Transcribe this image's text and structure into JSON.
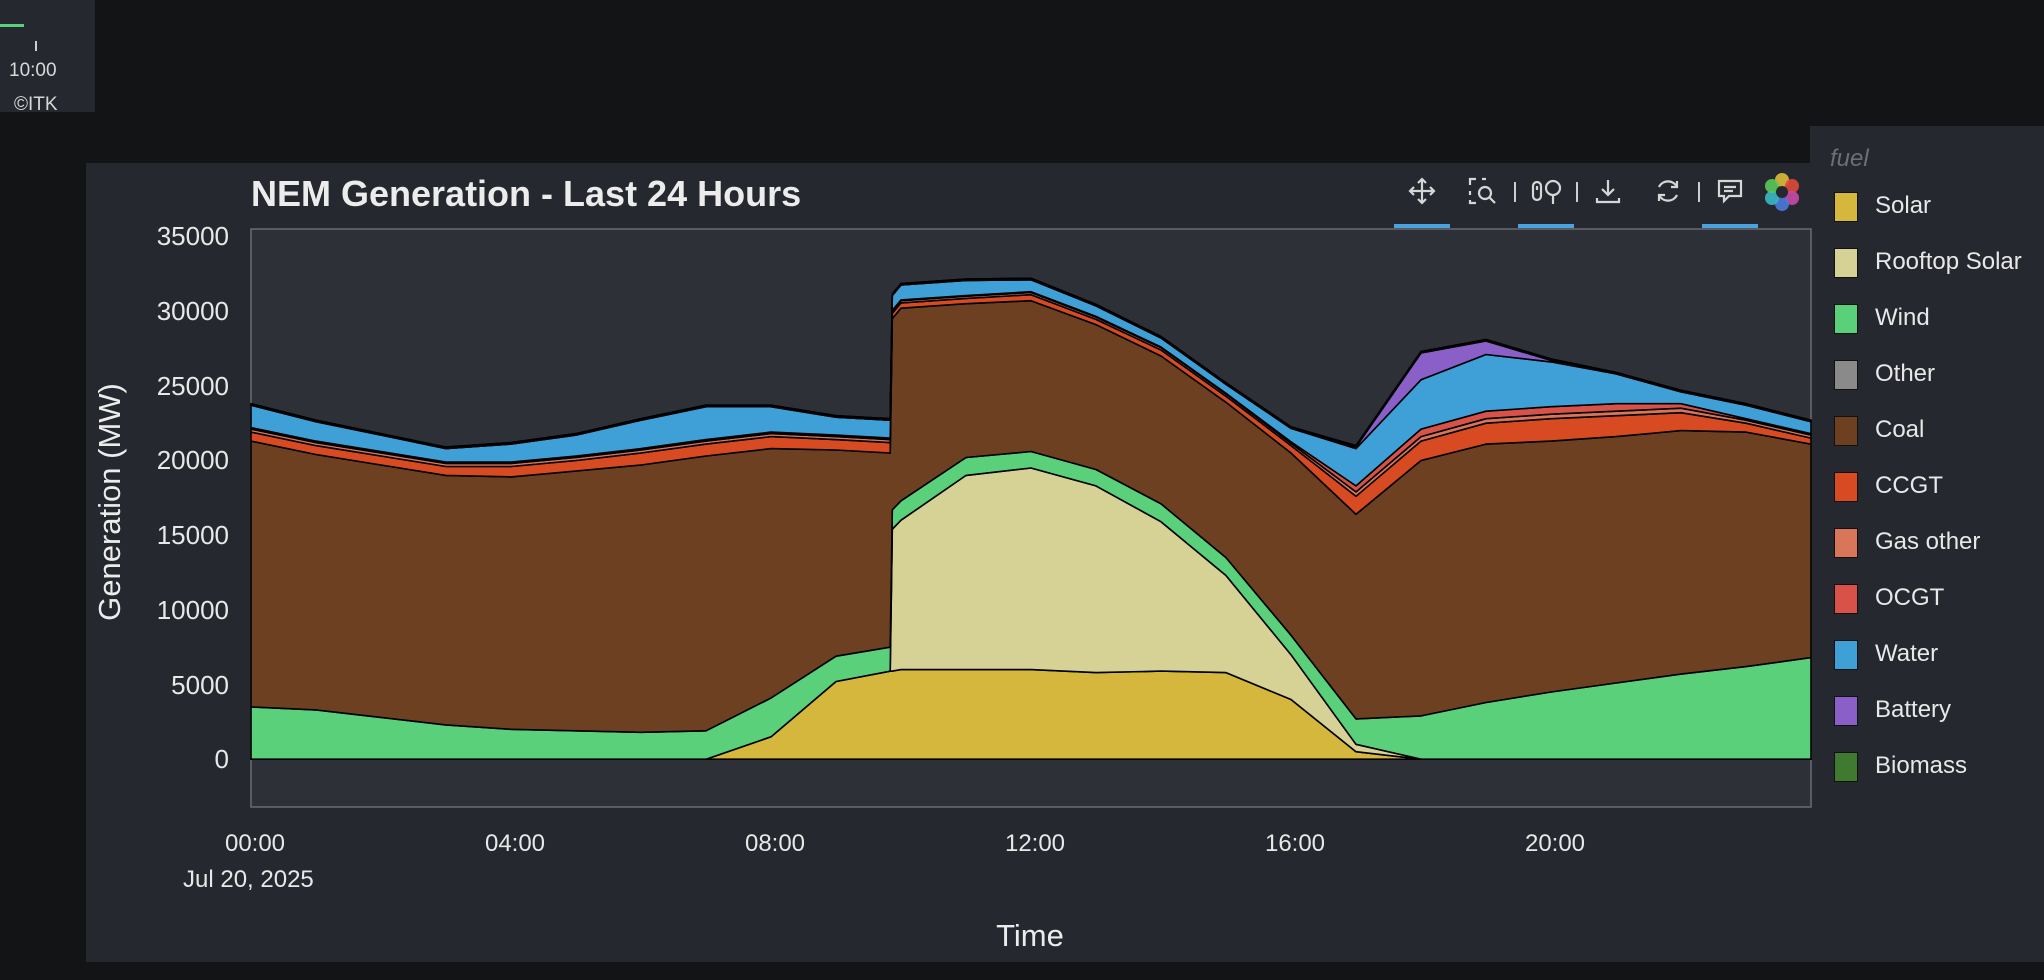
{
  "top_widget": {
    "tick_label": "10:00",
    "credit": "©ITK"
  },
  "toolbar": {
    "tools": [
      {
        "name": "pan-tool",
        "icon": "move-icon",
        "active": true
      },
      {
        "name": "box-zoom-tool",
        "icon": "box-zoom-icon",
        "active": false
      },
      {
        "name": "wheel-zoom-tool",
        "icon": "wheel-zoom-icon",
        "active": true
      },
      {
        "name": "save-tool",
        "icon": "download-icon",
        "active": false
      },
      {
        "name": "reset-tool",
        "icon": "reset-icon",
        "active": false
      },
      {
        "name": "hover-tool",
        "icon": "hover-icon",
        "active": true
      },
      {
        "name": "bokeh-logo",
        "icon": "bokeh-logo-icon",
        "active": false
      }
    ]
  },
  "legend": {
    "title": "fuel",
    "items": [
      {
        "label": "Solar",
        "color": "#d4b73c"
      },
      {
        "label": "Rooftop Solar",
        "color": "#d6d194"
      },
      {
        "label": "Wind",
        "color": "#5ad07a"
      },
      {
        "label": "Other",
        "color": "#8a8a8a"
      },
      {
        "label": "Coal",
        "color": "#6e4022"
      },
      {
        "label": "CCGT",
        "color": "#d84a22"
      },
      {
        "label": "Gas other",
        "color": "#d9765a"
      },
      {
        "label": "OCGT",
        "color": "#d9524a"
      },
      {
        "label": "Water",
        "color": "#3fa0d8"
      },
      {
        "label": "Battery",
        "color": "#8a60c8"
      },
      {
        "label": "Biomass",
        "color": "#3f7a30"
      }
    ]
  },
  "chart_data": {
    "type": "area",
    "stacked": true,
    "title": "NEM Generation - Last 24 Hours",
    "xlabel": "Time",
    "ylabel": "Generation (MW)",
    "x_ticks": [
      "00:00",
      "04:00",
      "08:00",
      "12:00",
      "16:00",
      "20:00"
    ],
    "x_date_label": "Jul 20, 2025",
    "y_ticks": [
      "0",
      "5000",
      "10000",
      "15000",
      "20000",
      "25000",
      "30000",
      "35000"
    ],
    "ylim": [
      -3200,
      35500
    ],
    "xlim": [
      "00:00",
      "24:00"
    ],
    "legend_position": "right",
    "x": [
      "00:00",
      "01:00",
      "02:00",
      "03:00",
      "04:00",
      "05:00",
      "06:00",
      "07:00",
      "08:00",
      "09:00",
      "09:50",
      "09:52",
      "10:00",
      "11:00",
      "12:00",
      "13:00",
      "14:00",
      "15:00",
      "16:00",
      "17:00",
      "18:00",
      "19:00",
      "20:00",
      "21:00",
      "22:00",
      "23:00",
      "24:00"
    ],
    "series": [
      {
        "name": "Solar",
        "values": [
          0,
          0,
          0,
          0,
          0,
          0,
          0,
          0,
          1500,
          5200,
          5900,
          5900,
          6000,
          6000,
          6000,
          5800,
          5900,
          5800,
          4000,
          500,
          0,
          0,
          0,
          0,
          0,
          0,
          0
        ]
      },
      {
        "name": "Rooftop Solar",
        "values": [
          0,
          0,
          0,
          0,
          0,
          0,
          0,
          0,
          0,
          0,
          0,
          9500,
          10000,
          13000,
          13500,
          12500,
          10000,
          6500,
          3000,
          500,
          0,
          0,
          0,
          0,
          0,
          0,
          0
        ]
      },
      {
        "name": "Wind",
        "values": [
          3500,
          3300,
          2800,
          2300,
          2000,
          1900,
          1800,
          1900,
          2600,
          1700,
          1600,
          1300,
          1300,
          1200,
          1100,
          1100,
          1200,
          1200,
          1300,
          1700,
          2900,
          3800,
          4500,
          5100,
          5700,
          6200,
          6800
        ]
      },
      {
        "name": "Coal",
        "values": [
          17800,
          17100,
          16900,
          16700,
          16900,
          17400,
          17900,
          18400,
          16700,
          13800,
          13000,
          12800,
          12900,
          10300,
          10100,
          9700,
          9900,
          10400,
          12200,
          13700,
          17100,
          17300,
          16800,
          16500,
          16300,
          15700,
          14300
        ]
      },
      {
        "name": "CCGT",
        "values": [
          600,
          600,
          600,
          600,
          700,
          700,
          800,
          800,
          800,
          700,
          700,
          350,
          350,
          350,
          400,
          350,
          400,
          400,
          500,
          1200,
          1300,
          1400,
          1500,
          1400,
          1200,
          600,
          400
        ]
      },
      {
        "name": "Gas other",
        "values": [
          200,
          200,
          200,
          200,
          200,
          200,
          200,
          200,
          200,
          200,
          200,
          150,
          150,
          150,
          150,
          150,
          150,
          150,
          150,
          300,
          300,
          300,
          300,
          300,
          300,
          200,
          200
        ]
      },
      {
        "name": "OCGT",
        "values": [
          100,
          100,
          100,
          100,
          100,
          100,
          100,
          100,
          100,
          100,
          100,
          50,
          50,
          50,
          50,
          50,
          50,
          50,
          100,
          400,
          500,
          500,
          500,
          500,
          300,
          100,
          100
        ]
      },
      {
        "name": "Water",
        "values": [
          1500,
          1300,
          1100,
          900,
          1200,
          1400,
          1900,
          2200,
          1700,
          1200,
          1200,
          1000,
          1000,
          1000,
          800,
          700,
          600,
          600,
          900,
          2500,
          3300,
          3800,
          3000,
          2000,
          800,
          900,
          800
        ]
      },
      {
        "name": "Battery",
        "values": [
          0,
          0,
          0,
          0,
          0,
          0,
          0,
          0,
          0,
          0,
          0,
          0,
          0,
          0,
          0,
          0,
          0,
          0,
          0,
          100,
          1800,
          900,
          100,
          0,
          0,
          0,
          0
        ]
      },
      {
        "name": "Other",
        "values": [
          100,
          100,
          100,
          100,
          100,
          100,
          100,
          100,
          100,
          100,
          100,
          100,
          100,
          100,
          100,
          100,
          100,
          100,
          100,
          100,
          100,
          100,
          100,
          100,
          100,
          100,
          100
        ]
      },
      {
        "name": "Biomass",
        "values": [
          0,
          0,
          0,
          0,
          0,
          0,
          0,
          0,
          0,
          0,
          0,
          0,
          0,
          0,
          0,
          0,
          0,
          0,
          0,
          0,
          0,
          0,
          0,
          0,
          0,
          0,
          0
        ]
      }
    ]
  }
}
